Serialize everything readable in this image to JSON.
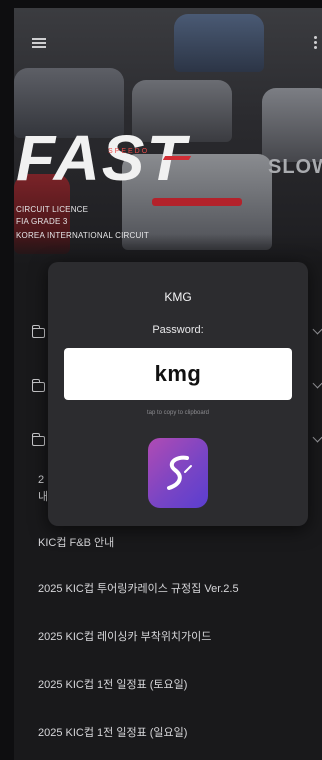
{
  "hero": {
    "logo_text": "FAST",
    "logo_tag": "SPEEDO",
    "side_text": "SLOW",
    "line1": "CIRCUIT LICENCE",
    "line2": "FIA GRADE 3",
    "line3": "KOREA INTERNATIONAL CIRCUIT"
  },
  "list": {
    "partial_item": "2",
    "partial_item_line2": "내",
    "items": [
      "KIC컵 F&B 안내",
      "2025 KIC컵 투어링카레이스 규정집 Ver.2.5",
      "2025 KIC컵 레이싱카 부착위치가이드",
      "2025 KIC컵 1전 일정표 (토요일)",
      "2025 KIC컵 1전 일정표 (일요일)"
    ]
  },
  "modal": {
    "title": "KMG",
    "password_label": "Password:",
    "password_value": "kmg",
    "hint": "tap to copy to clipboard"
  },
  "colors": {
    "background": "#19191b",
    "modal": "#2c2c2f",
    "accent_red": "#d12d35",
    "app_icon_start": "#b04bb4",
    "app_icon_end": "#5a3ed0"
  },
  "icons": {
    "menu": "hamburger-icon",
    "more": "more-vertical-icon",
    "folder": "folder-icon",
    "chevron": "chevron-down-icon",
    "app": "app-s-logo-icon"
  }
}
